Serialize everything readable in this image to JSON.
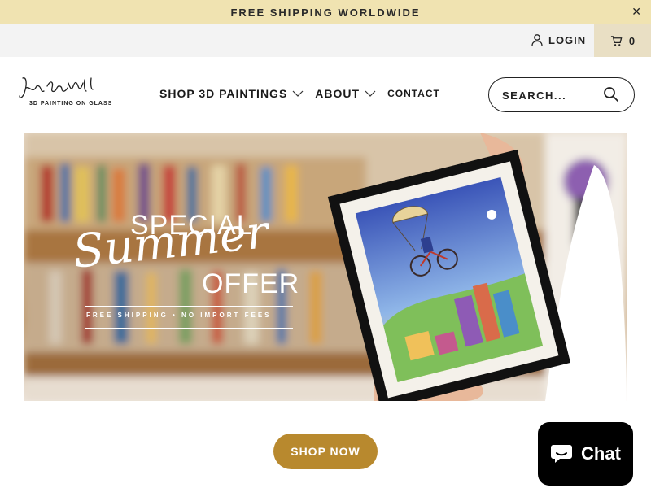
{
  "announcement": {
    "text": "FREE SHIPPING WORLDWIDE",
    "close_icon": "close-icon"
  },
  "utility": {
    "login_label": "LOGIN",
    "cart_count": "0"
  },
  "logo": {
    "signature": "Jean Pierre Weill",
    "tagline": "3D PAINTING ON GLASS"
  },
  "nav": {
    "items": [
      {
        "label": "SHOP 3D PAINTINGS",
        "has_dropdown": true
      },
      {
        "label": "ABOUT",
        "has_dropdown": true
      },
      {
        "label": "CONTACT",
        "has_dropdown": false
      }
    ]
  },
  "search": {
    "placeholder": "SEARCH..."
  },
  "hero": {
    "line1": "SPECIAL",
    "line2": "Summer",
    "line3": "OFFER",
    "fine_print": "FREE SHIPPING • NO IMPORT FEES"
  },
  "cta": {
    "label": "SHOP NOW"
  },
  "chat": {
    "label": "Chat"
  },
  "colors": {
    "announcement_bg": "#f0e3b1",
    "cta_bg": "#b8892e",
    "cart_bg": "#e9dfc4",
    "chat_bg": "#000000"
  }
}
